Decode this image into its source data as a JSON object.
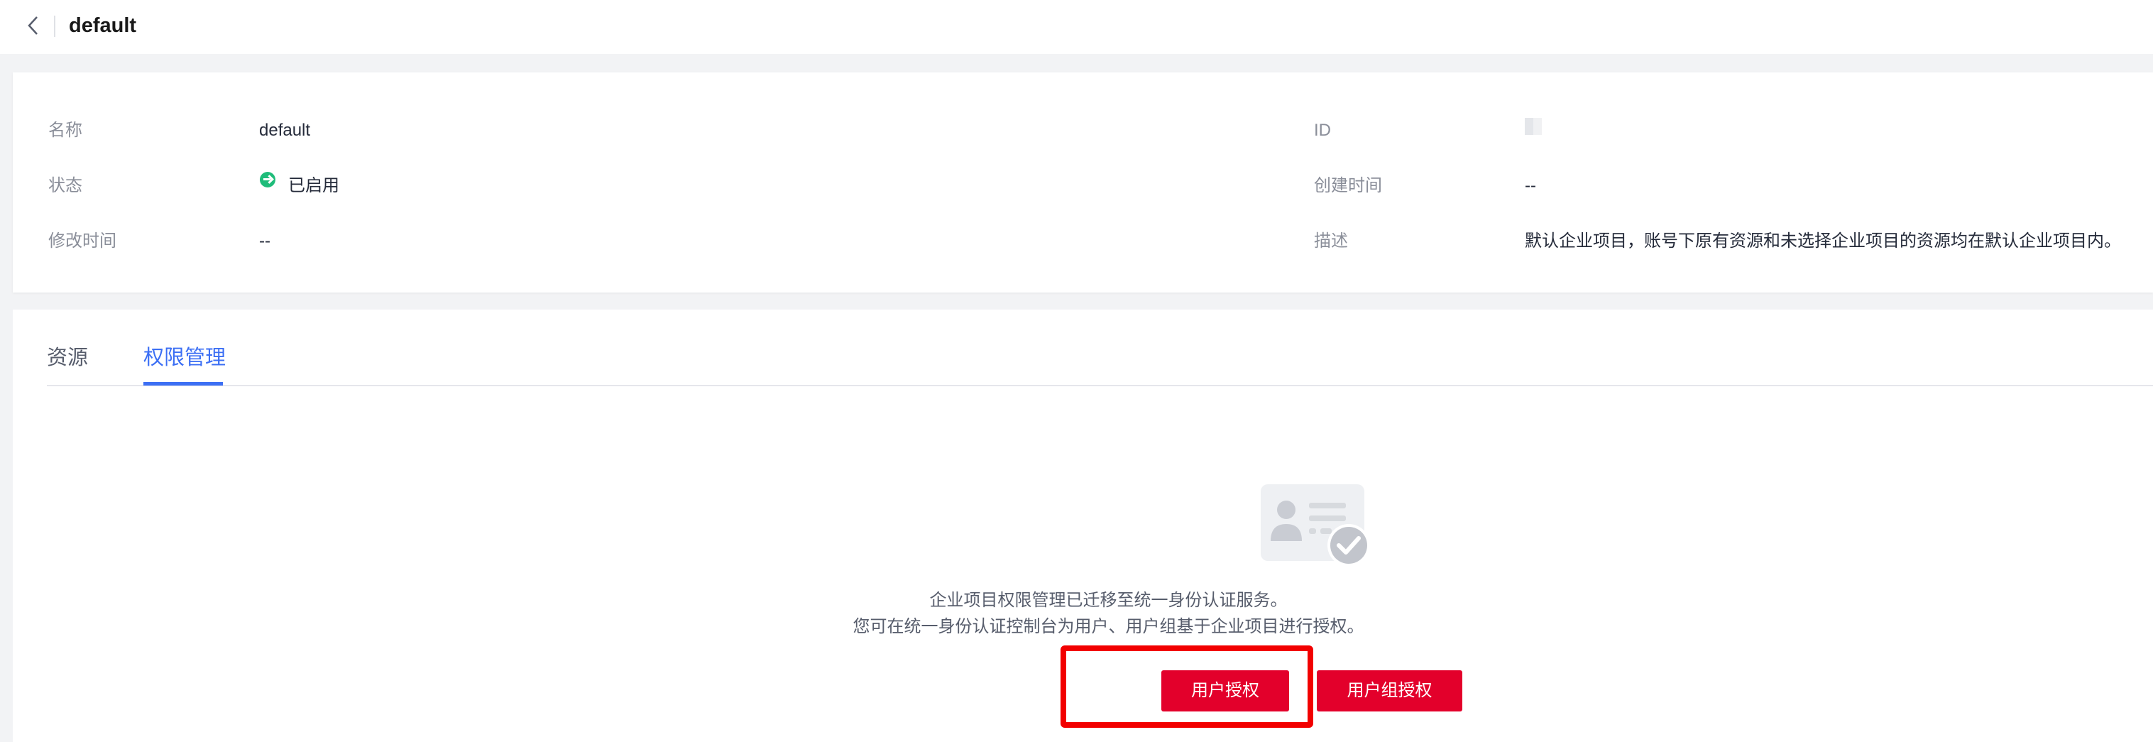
{
  "header": {
    "title": "default",
    "back_icon": "chevron-left-icon"
  },
  "info": {
    "name_label": "名称",
    "name_value": "default",
    "status_label": "状态",
    "status_value": "已启用",
    "status_color": "#1fbc7a",
    "modified_label": "修改时间",
    "modified_value": "--",
    "id_label": "ID",
    "id_value": "",
    "created_label": "创建时间",
    "created_value": "--",
    "desc_label": "描述",
    "desc_value": "默认企业项目，账号下原有资源和未选择企业项目的资源均在默认企业项目内。"
  },
  "tabs": [
    {
      "label": "资源",
      "active": false
    },
    {
      "label": "权限管理",
      "active": true
    }
  ],
  "empty_state": {
    "icon": "user-card-check-icon",
    "line1": "企业项目权限管理已迁移至统一身份认证服务。",
    "line2": "您可在统一身份认证控制台为用户、用户组基于企业项目进行授权。"
  },
  "actions": {
    "user_auth_label": "用户授权",
    "group_auth_label": "用户组授权",
    "button_color": "#e3002b"
  },
  "accent_color": "#3c6ff4"
}
